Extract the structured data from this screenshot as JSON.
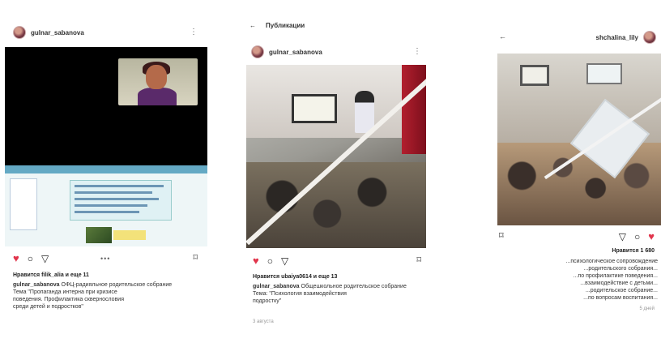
{
  "posts": [
    {
      "username": "gulnar_sabanova",
      "more_icon": "kebab-icon",
      "likes_text": "Нравится filik_alia и еще 11",
      "caption_user": "gulnar_sabanova",
      "caption_text": "ОФЦ-радияльное родительское собрание",
      "caption_lines": [
        "Тема \"Пропаганда интерна при кризисе",
        "поведения. Профилактика сквернословия",
        "среди детей и подростков\""
      ]
    },
    {
      "top_title": "Публикации",
      "username": "gulnar_sabanova",
      "more_icon": "kebab-icon",
      "likes_text": "Нравится ubaiya0614 и еще 13",
      "caption_user": "gulnar_sabanova",
      "caption_text": "Общешкольное родительское собрание",
      "caption_lines": [
        "Тема: \"Психология взаимодействия",
        "подростку\""
      ],
      "time": "3 августа"
    },
    {
      "username": "shchalina_lily",
      "likes_text": "Нравится 1 680",
      "caption_lines": [
        "...психологическое сопровождение",
        "...родительского собрания...",
        "...по профилактике поведения...",
        "...взаимодействие с детьми...",
        "...родительское собрание...",
        "...по вопросам воспитания..."
      ],
      "time": "5 дней"
    }
  ],
  "colors": {
    "like": "#e1354c",
    "text": "#222222"
  }
}
